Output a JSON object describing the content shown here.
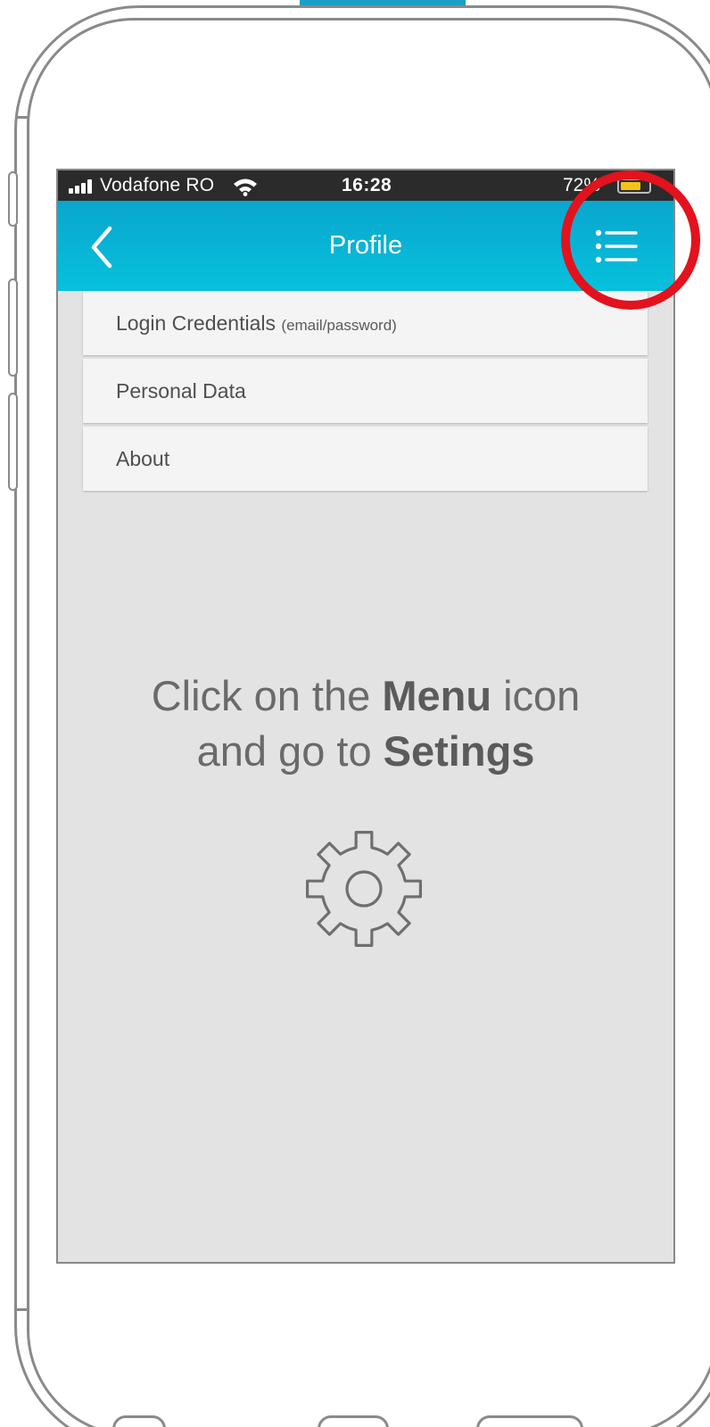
{
  "status_bar": {
    "carrier": "Vodafone RO",
    "time": "16:28",
    "battery_percent": "72%",
    "battery_level": 0.72,
    "battery_color": "#f3c417",
    "signal_icon": "signal-bars-icon",
    "wifi_icon": "wifi-icon"
  },
  "app_bar": {
    "title": "Profile",
    "back_icon": "chevron-left-icon",
    "menu_icon": "list-menu-icon",
    "gradient_top": "#0aa6cd",
    "gradient_bottom": "#06c1dc"
  },
  "menu_items": [
    {
      "label": "Login Credentials",
      "hint": "(email/password)"
    },
    {
      "label": "Personal Data",
      "hint": ""
    },
    {
      "label": "About",
      "hint": ""
    }
  ],
  "instruction": {
    "line1_a": "Click on the ",
    "line1_bold": "Menu",
    "line1_b": " icon",
    "line2_a": "and go to ",
    "line2_bold": "Setings"
  },
  "illustration": {
    "icon": "gear-icon"
  },
  "highlight": {
    "color": "#e3121d",
    "target": "menu-button"
  }
}
